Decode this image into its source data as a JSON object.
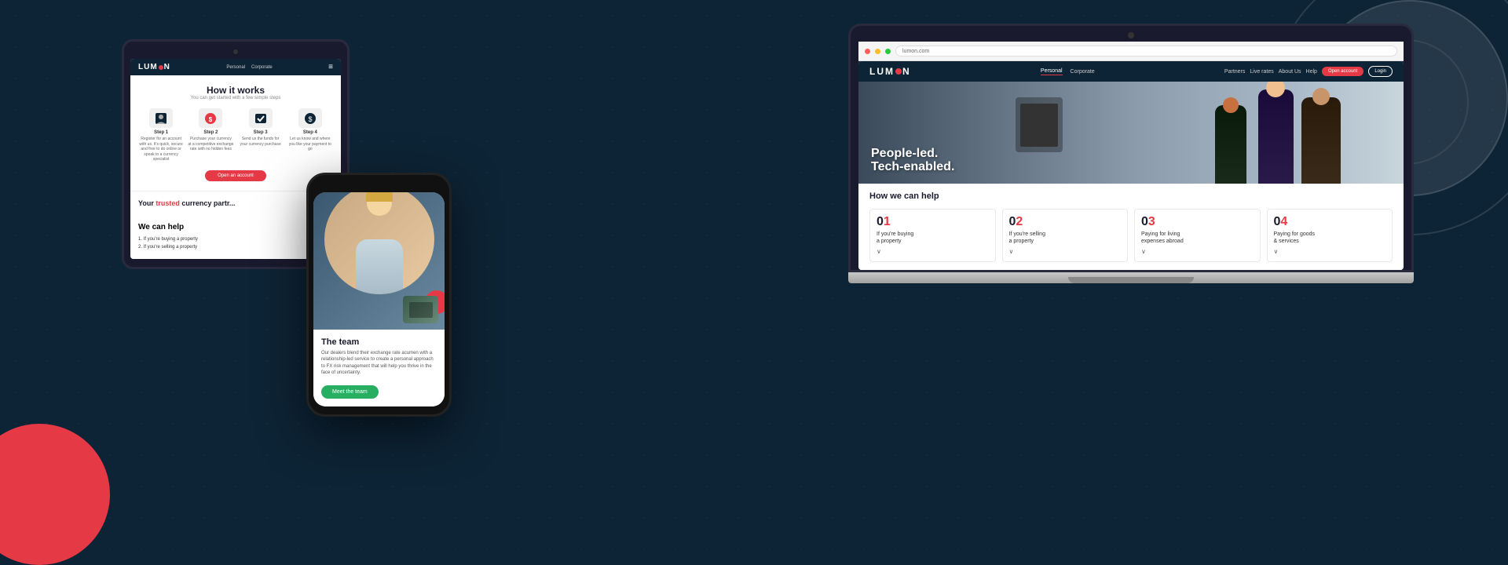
{
  "background": {
    "color": "#0d2436"
  },
  "laptop": {
    "browser": {
      "url": "lumon.com"
    },
    "nav": {
      "logo": "LUM N",
      "links": [
        "Personal",
        "Corporate"
      ],
      "right_links": [
        "Partners",
        "Live rates",
        "About Us",
        "Help"
      ],
      "open_account": "Open account",
      "login": "Login"
    },
    "hero": {
      "headline_line1": "People-led.",
      "headline_line2": "Tech-enabled."
    },
    "help_section": {
      "title": "How we can help",
      "cards": [
        {
          "number": "01",
          "label": "If you're buying\na property"
        },
        {
          "number": "02",
          "label": "If you're selling\na property"
        },
        {
          "number": "03",
          "label": "Paying for living\nexpenses abroad"
        },
        {
          "number": "04",
          "label": "Paying for goods\n& services"
        }
      ]
    }
  },
  "tablet": {
    "nav": {
      "logo": "LUM N",
      "links": [
        "Personal",
        "Corporate"
      ]
    },
    "how_section": {
      "title": "How it works",
      "subtitle": "You can get started with a few simple steps",
      "steps": [
        {
          "label": "Step 1",
          "desc": "Register for an account with us. It's quick, secure and free to do online or speak to a currency specialist"
        },
        {
          "label": "Step 2",
          "desc": "Purchase your currency at a competitive exchange rate with no hidden fees"
        },
        {
          "label": "Step 3",
          "desc": "Send us the funds for your currency purchase"
        },
        {
          "label": "Step 4",
          "desc": "Let us know and where you like your payment to go"
        }
      ],
      "open_btn": "Open an account"
    },
    "trusted": {
      "text": "Your trusted currency partr..."
    },
    "we_can_help": {
      "title": "We can help",
      "items": [
        "1. If you're buying a property",
        "2. If you're selling a property"
      ]
    }
  },
  "phone": {
    "team_section": {
      "title": "The team",
      "desc": "Our dealers blend their exchange rate acumen with a relationship-led service to create a personal approach to FX risk management that will help you thrive in the face of uncertainty.",
      "meet_btn": "Meet the team"
    }
  }
}
